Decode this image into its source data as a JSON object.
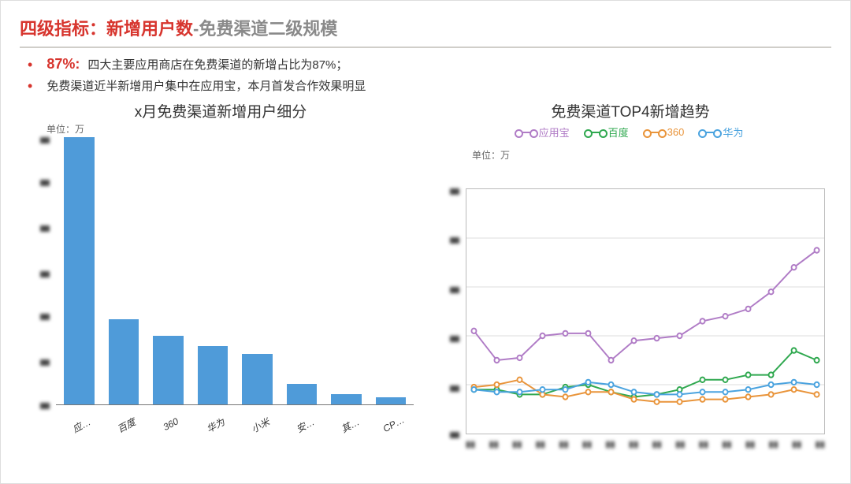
{
  "title": {
    "prefix": "四级指标：新增用户数",
    "suffix": "-免费渠道二级规模"
  },
  "bullets": [
    {
      "highlight": "87%:",
      "text": "四大主要应用商店在免费渠道的新增占比为87%；"
    },
    {
      "highlight": "",
      "text": "免费渠道近半新增用户集中在应用宝，本月首发合作效果明显"
    }
  ],
  "left_chart_title": "x月免费渠道新增用户细分",
  "right_chart_title": "免费渠道TOP4新增趋势",
  "unit_label": "单位：万",
  "legend": [
    {
      "name": "应用宝",
      "color": "#b07cc6"
    },
    {
      "name": "百度",
      "color": "#2fa84f"
    },
    {
      "name": "360",
      "color": "#e9943a"
    },
    {
      "name": "华为",
      "color": "#4aa3df"
    }
  ],
  "chart_data": [
    {
      "type": "bar",
      "title": "x月免费渠道新增用户细分",
      "ylabel": "单位：万",
      "categories": [
        "应…",
        "百度",
        "360",
        "华为",
        "小米",
        "安…",
        "其…",
        "CP…"
      ],
      "values": [
        100,
        32,
        26,
        22,
        19,
        8,
        4,
        3
      ],
      "ylim_note": "y-axis tick labels obscured in source image"
    },
    {
      "type": "line",
      "title": "免费渠道TOP4新增趋势",
      "ylabel": "单位：万",
      "x_index": [
        1,
        2,
        3,
        4,
        5,
        6,
        7,
        8,
        9,
        10,
        11,
        12,
        13,
        14,
        15,
        16
      ],
      "x_note": "x-axis labels obscured/blurred in source image",
      "series": [
        {
          "name": "应用宝",
          "color": "#b07cc6",
          "values": [
            42,
            30,
            31,
            40,
            41,
            41,
            30,
            38,
            39,
            40,
            46,
            48,
            51,
            58,
            68,
            75
          ]
        },
        {
          "name": "百度",
          "color": "#2fa84f",
          "values": [
            18,
            18,
            16,
            16,
            19,
            20,
            17,
            15,
            16,
            18,
            22,
            22,
            24,
            24,
            34,
            30
          ]
        },
        {
          "name": "360",
          "color": "#e9943a",
          "values": [
            19,
            20,
            22,
            16,
            15,
            17,
            17,
            14,
            13,
            13,
            14,
            14,
            15,
            16,
            18,
            16
          ]
        },
        {
          "name": "华为",
          "color": "#4aa3df",
          "values": [
            18,
            17,
            17,
            18,
            18,
            21,
            20,
            17,
            16,
            16,
            17,
            17,
            18,
            20,
            21,
            20
          ]
        }
      ],
      "ylim": [
        0,
        100
      ]
    }
  ]
}
